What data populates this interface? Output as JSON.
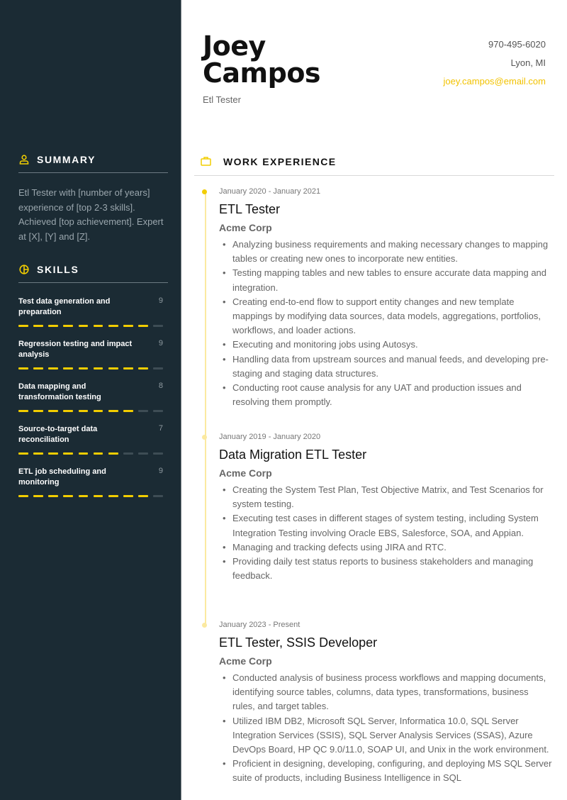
{
  "header": {
    "first_name": "Joey",
    "last_name": "Campos",
    "job_title": "Etl Tester",
    "phone": "970-495-6020",
    "location": "Lyon, MI",
    "email": "joey.campos@email.com"
  },
  "colors": {
    "sidebar_bg": "#1b2b34",
    "accent": "#f2cd00",
    "accent_light": "#fbe9a0"
  },
  "summary": {
    "heading": "SUMMARY",
    "icon": "user-icon",
    "text": "Etl Tester with [number of years] experience of [top 2-3 skills]. Achieved [top achievement]. Expert at [X], [Y] and [Z]."
  },
  "skills": {
    "heading": "SKILLS",
    "icon": "pie-chart-icon",
    "scale_max": 10,
    "items": [
      {
        "name": "Test data generation and preparation",
        "rating": 9
      },
      {
        "name": "Regression testing and impact analysis",
        "rating": 9
      },
      {
        "name": "Data mapping and transformation testing",
        "rating": 8
      },
      {
        "name": "Source-to-target data reconciliation",
        "rating": 7
      },
      {
        "name": "ETL job scheduling and monitoring",
        "rating": 9
      }
    ]
  },
  "work_experience": {
    "heading": "WORK EXPERIENCE",
    "icon": "briefcase-icon",
    "jobs": [
      {
        "dates": "January 2020 - January 2021",
        "title": "ETL Tester",
        "company": "Acme Corp",
        "bullets": [
          "Analyzing business requirements and making necessary changes to mapping tables or creating new ones to incorporate new entities.",
          "Testing mapping tables and new tables to ensure accurate data mapping and integration.",
          "Creating end-to-end flow to support entity changes and new template mappings by modifying data sources, data models, aggregations, portfolios, workflows, and loader actions.",
          "Executing and monitoring jobs using Autosys.",
          "Handling data from upstream sources and manual feeds, and developing pre-staging and staging data structures.",
          "Conducting root cause analysis for any UAT and production issues and resolving them promptly."
        ]
      },
      {
        "dates": "January 2019 - January 2020",
        "title": "Data Migration ETL Tester",
        "company": "Acme Corp",
        "bullets": [
          "Creating the System Test Plan, Test Objective Matrix, and Test Scenarios for system testing.",
          "Executing test cases in different stages of system testing, including System Integration Testing involving Oracle EBS, Salesforce, SOA, and Appian.",
          "Managing and tracking defects using JIRA and RTC.",
          "Providing daily test status reports to business stakeholders and managing feedback."
        ]
      },
      {
        "dates": "January 2023 - Present",
        "title": "ETL Tester, SSIS Developer",
        "company": "Acme Corp",
        "bullets": [
          "Conducted analysis of business process workflows and mapping documents, identifying source tables, columns, data types, transformations, business rules, and target tables.",
          "Utilized IBM DB2, Microsoft SQL Server, Informatica 10.0, SQL Server Integration Services (SSIS), SQL Server Analysis Services (SSAS), Azure DevOps Board, HP QC 9.0/11.0, SOAP UI, and Unix in the work environment.",
          "Proficient in designing, developing, configuring, and deploying MS SQL Server suite of products, including Business Intelligence in SQL"
        ]
      }
    ]
  }
}
